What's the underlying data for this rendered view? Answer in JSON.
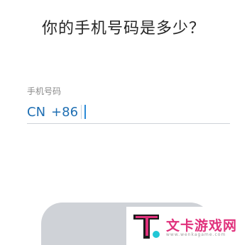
{
  "header": {
    "title": "你的手机号码是多少？"
  },
  "phone_field": {
    "label": "手机号码",
    "country_code": "CN",
    "dial_code": "+86",
    "value": ""
  },
  "next_button": {
    "label": ""
  },
  "watermark": {
    "brand": "文卡游戏网",
    "url": "www.wenkagame.com"
  }
}
